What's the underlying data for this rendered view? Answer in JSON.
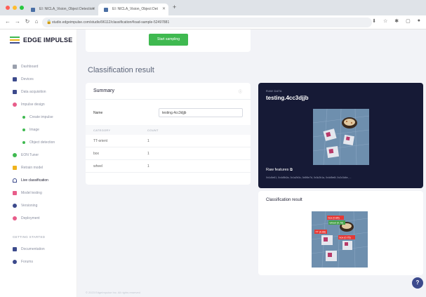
{
  "browser": {
    "tabs": [
      {
        "label": "EI: NICLA_Vision_Object Detection"
      },
      {
        "label": "EI: NICLA_Vision_Object Det"
      }
    ],
    "url": "studio.edgeimpulse.com/studio/96112/classification#load-sample-52497881"
  },
  "sidebar": {
    "brand": "EDGE IMPULSE",
    "brand_colors": [
      "#3fb950",
      "#f0b31c",
      "#3c4a8c"
    ],
    "items": [
      {
        "label": "Dashboard",
        "icon": "dashboard-icon",
        "color": "#9aa0ad"
      },
      {
        "label": "Devices",
        "icon": "devices-icon",
        "color": "#3c4a8c"
      },
      {
        "label": "Data acquisition",
        "icon": "data-acquisition-icon",
        "color": "#3c4a8c"
      },
      {
        "label": "Impulse design",
        "icon": "impulse-design-icon",
        "color": "#e85d8a"
      }
    ],
    "subitems": [
      {
        "label": "Create impulse"
      },
      {
        "label": "Image"
      },
      {
        "label": "Object detection"
      }
    ],
    "items2": [
      {
        "label": "EON Tuner",
        "icon": "eon-tuner-icon",
        "color": "#3fb950"
      },
      {
        "label": "Retrain model",
        "icon": "retrain-model-icon",
        "color": "#f0b31c"
      },
      {
        "label": "Live classification",
        "icon": "live-classification-icon",
        "color": "#3c4a8c"
      },
      {
        "label": "Model testing",
        "icon": "model-testing-icon",
        "color": "#e85d8a"
      },
      {
        "label": "Versioning",
        "icon": "versioning-icon",
        "color": "#3c4a8c"
      },
      {
        "label": "Deployment",
        "icon": "deployment-icon",
        "color": "#e85d8a"
      }
    ],
    "section_label": "GETTING STARTED",
    "items3": [
      {
        "label": "Documentation",
        "icon": "documentation-icon",
        "color": "#3c4a8c"
      },
      {
        "label": "Forums",
        "icon": "forums-icon",
        "color": "#3c4a8c"
      }
    ]
  },
  "main": {
    "start_button": "Start sampling",
    "section_title": "Classification result",
    "summary": {
      "title": "Summary",
      "name_label": "Name",
      "name_value": "testing.4cc3djjb",
      "col_category": "CATEGORY",
      "col_count": "COUNT",
      "rows": [
        {
          "category": "TT-orient",
          "count": "1"
        },
        {
          "category": "box",
          "count": "1"
        },
        {
          "category": "wheel",
          "count": "1"
        }
      ]
    },
    "raw": {
      "label": "RAW DATA",
      "name": "testing.4cc3djjb",
      "features_label": "Raw features",
      "features_values": "0x1c5e61, 0x4d5b2a, 0x1a2b3c, 0x5f6e7d, 0x3c2b1a, 0x4d5e6f, 0x2c3d4e, ..."
    },
    "classification": {
      "title": "Classification result",
      "labels": [
        {
          "text": "box (0.85)",
          "color": "#e53935"
        },
        {
          "text": "wheel (0.78)",
          "color": "#43a047"
        },
        {
          "text": "TT (0.66)",
          "color": "#e53935"
        },
        {
          "text": "box (0.75)",
          "color": "#e53935"
        }
      ]
    },
    "help_label": "?",
    "footer": "© 2023 EdgeImpulse Inc. All rights reserved"
  }
}
